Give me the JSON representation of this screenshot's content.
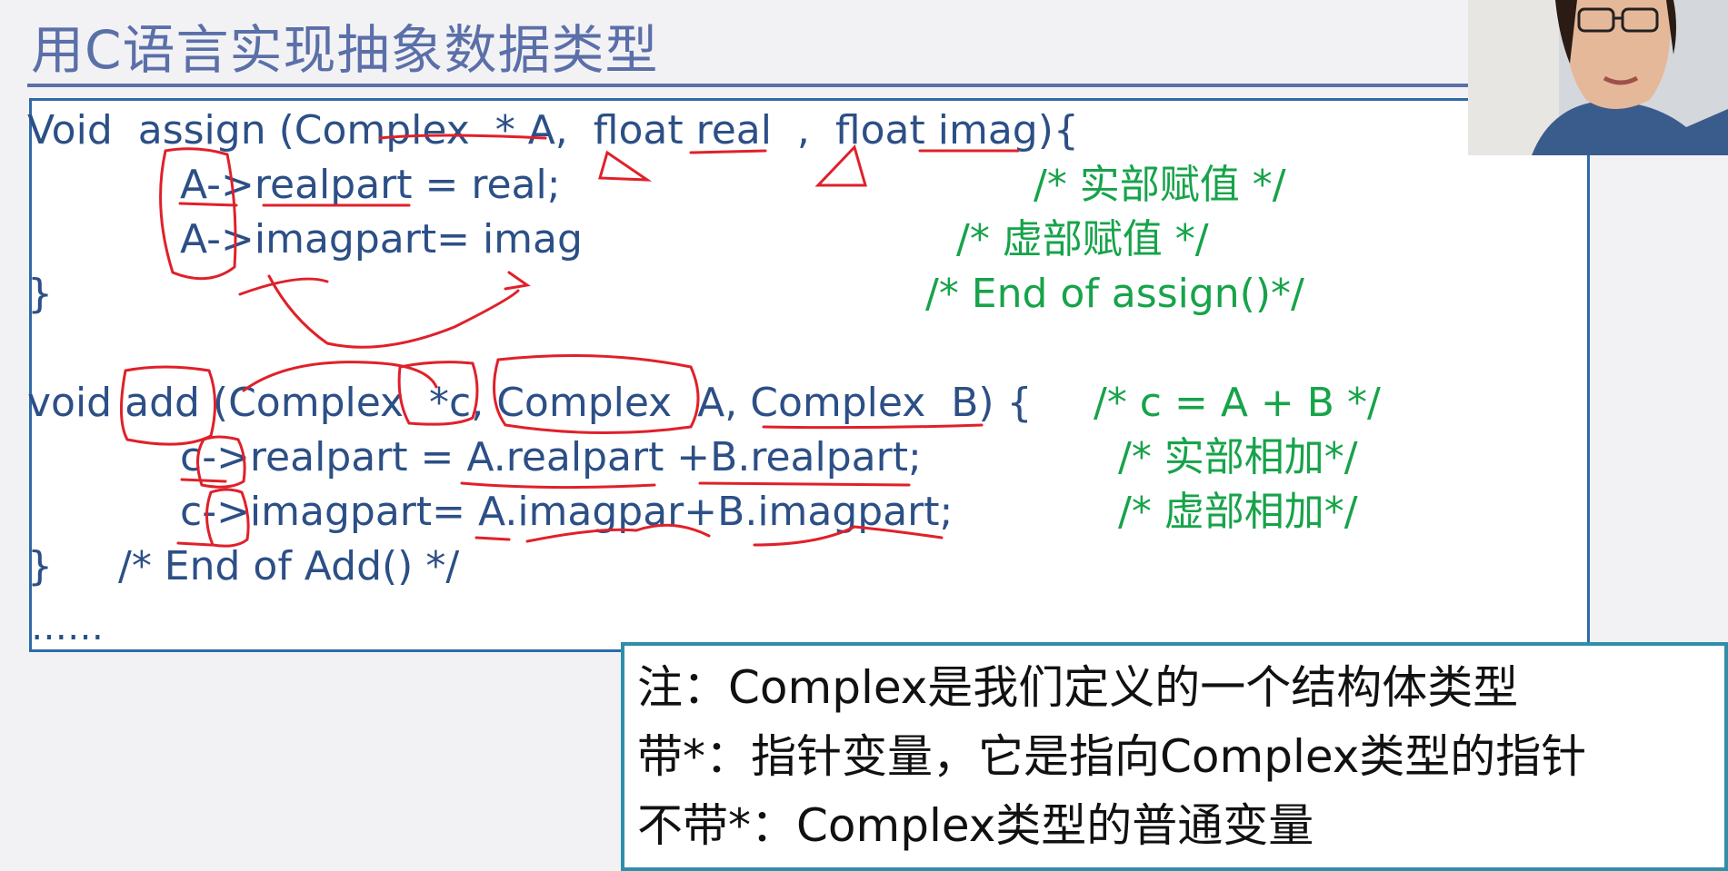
{
  "slide": {
    "title": "用C语言实现抽象数据类型"
  },
  "code": {
    "assign_signature": "Void  assign (Complex  * A,  float real  ,  float imag){",
    "assign_line1": "A->realpart = real;",
    "assign_line1_comment": "/* 实部赋值 */",
    "assign_line2": "A->imagpart= imag",
    "assign_line2_comment": "/* 虚部赋值 */",
    "assign_close": "}",
    "assign_end_comment": "/* End of assign()*/",
    "add_signature": "void add (Complex  *c, Complex  A, Complex  B) {",
    "add_signature_comment": "/* c = A + B */",
    "add_line1": "c->realpart = A.realpart +B.realpart;",
    "add_line1_comment": "/* 实部相加*/",
    "add_line2": "c->imagpart= A.imagpar+B.imagpart;",
    "add_line2_comment": "/* 虚部相加*/",
    "add_close": "}",
    "add_end_comment": "/* End of Add() */",
    "ellipsis": "……"
  },
  "note": {
    "line1": "注：Complex是我们定义的一个结构体类型",
    "line2": "带*：指针变量，它是指向Complex类型的指针",
    "line3": "不带*：Complex类型的普通变量"
  },
  "colors": {
    "title": "#5b6fa8",
    "code_text": "#2c4f86",
    "comment_text": "#17a34a",
    "code_border": "#2f6aa8",
    "note_border": "#2f8fa8",
    "annotation_ink": "#e0202a"
  }
}
